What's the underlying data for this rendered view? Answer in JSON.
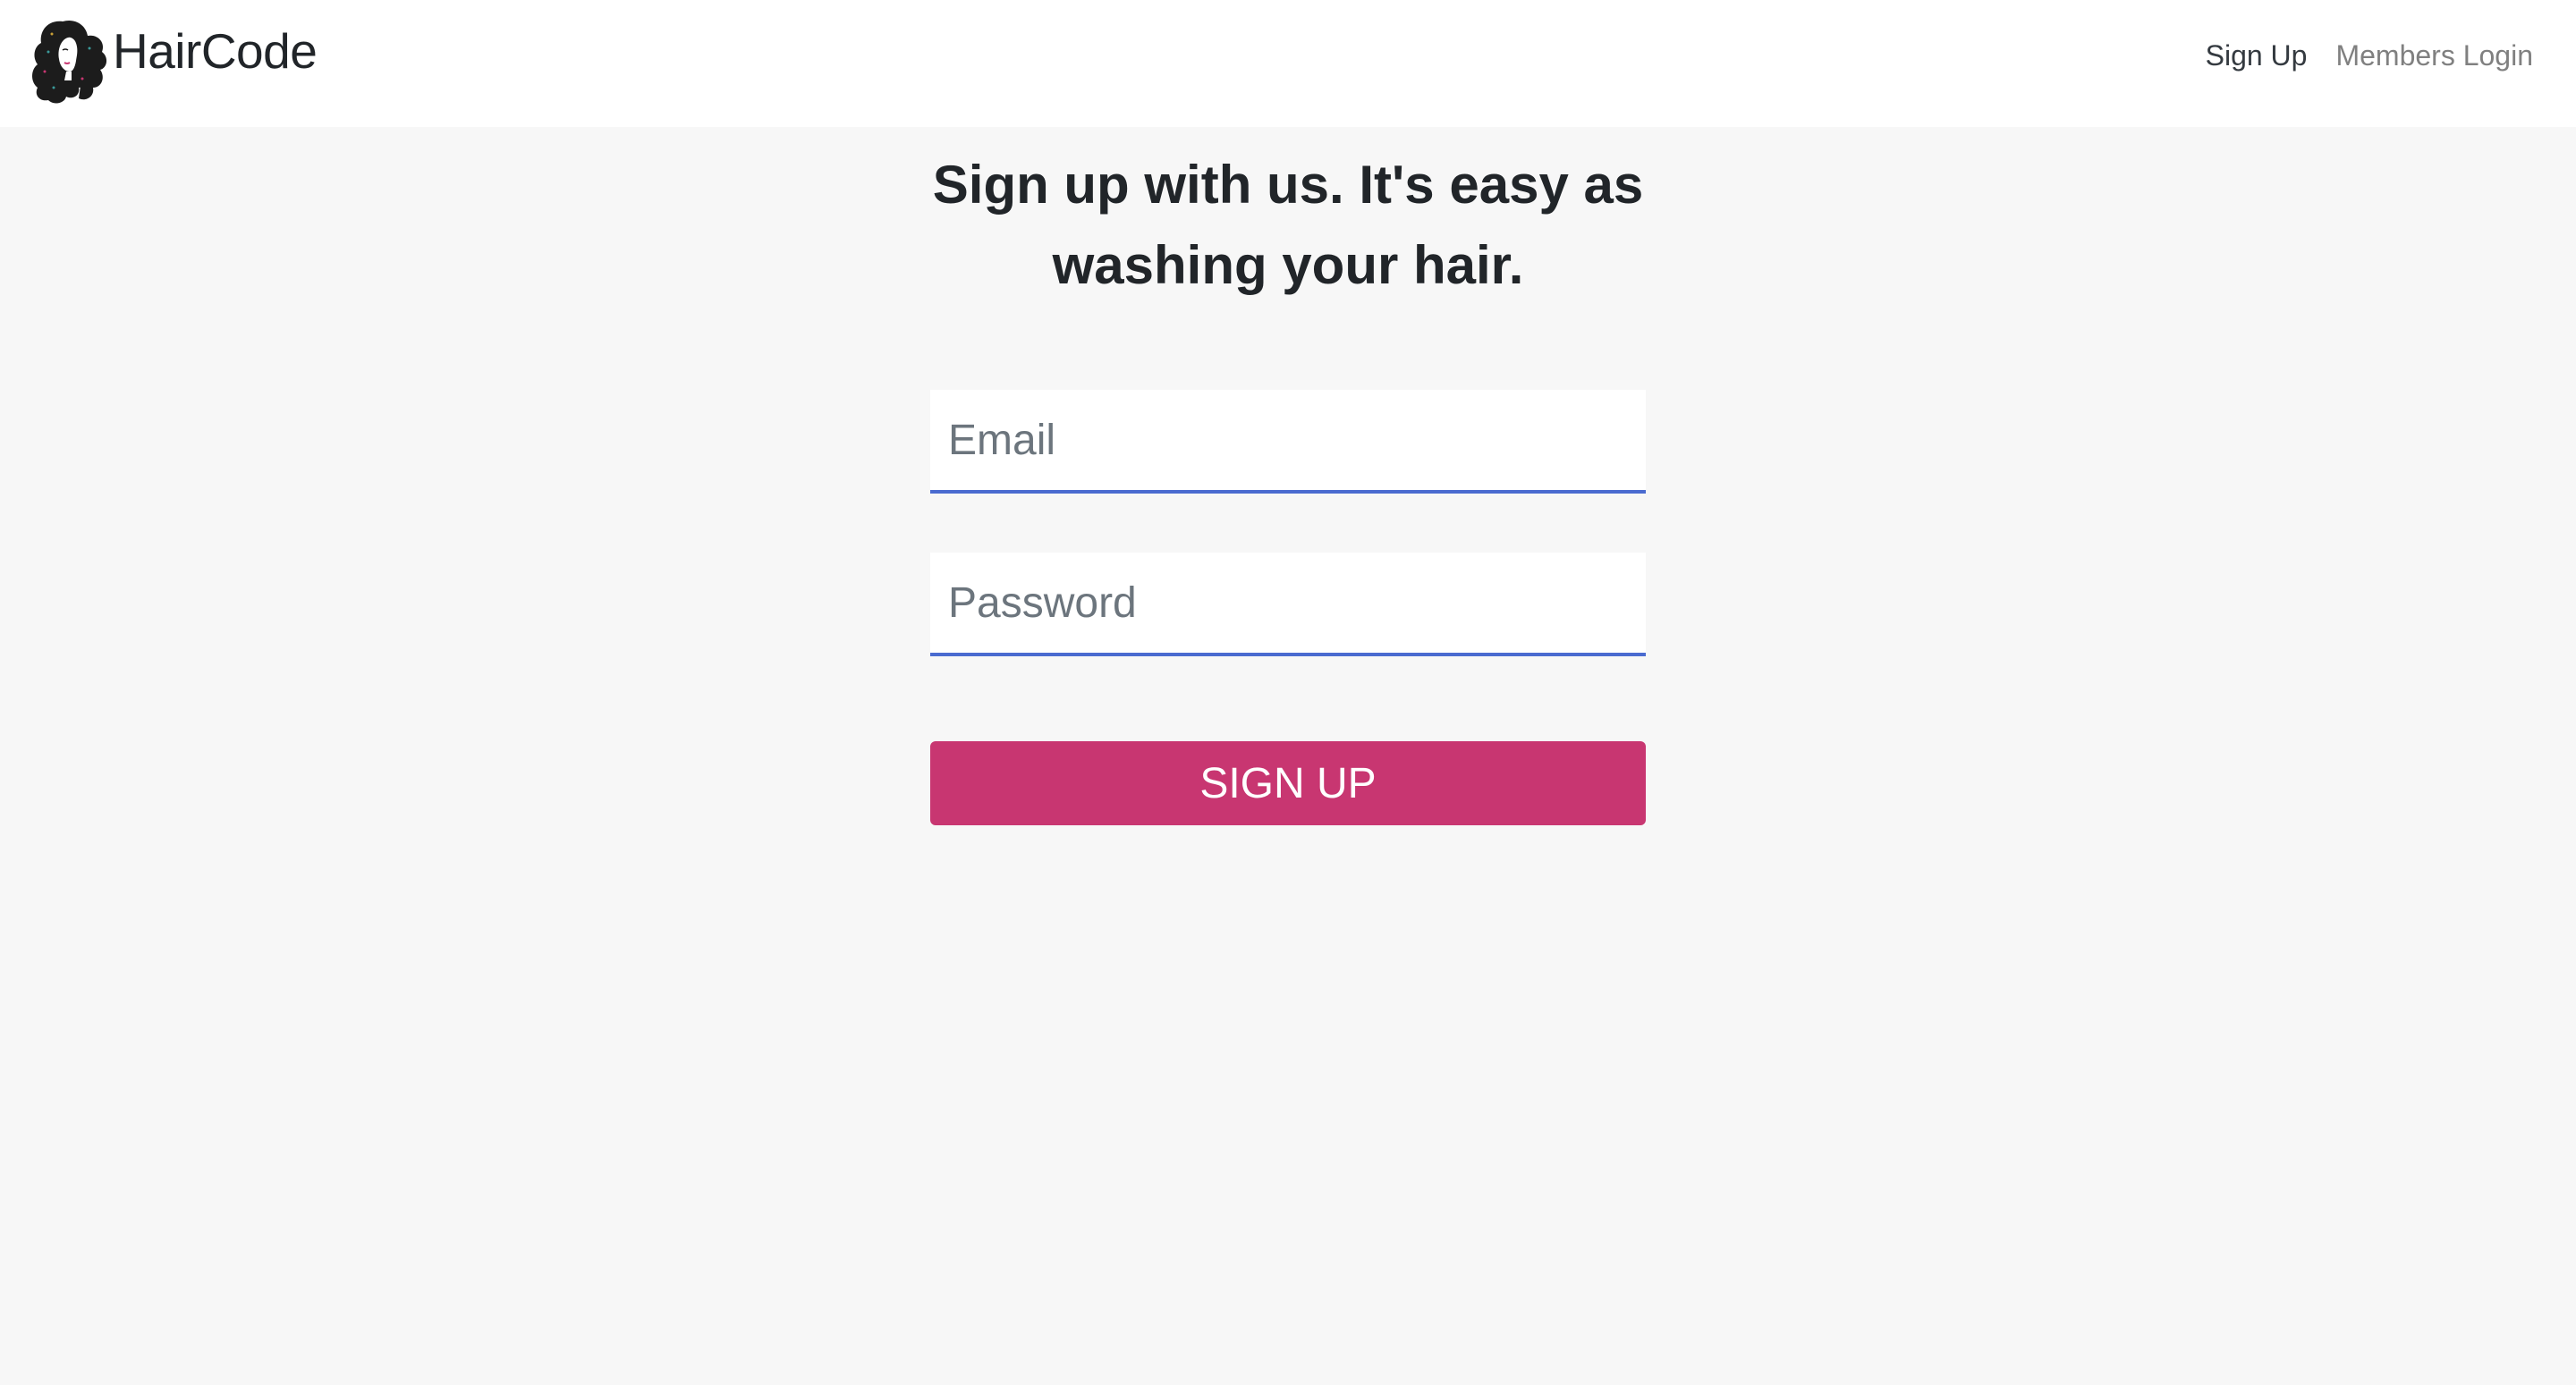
{
  "brand": {
    "name": "HairCode",
    "logo_icon": "woman-curly-hair-logo-icon"
  },
  "nav": {
    "items": [
      {
        "label": "Sign Up",
        "state": "active"
      },
      {
        "label": "Members Login",
        "state": "inactive"
      }
    ]
  },
  "form": {
    "heading": "Sign up with us. It's easy as washing your hair.",
    "email": {
      "placeholder": "Email",
      "value": ""
    },
    "password": {
      "placeholder": "Password",
      "value": ""
    },
    "submit_label": "SIGN UP"
  },
  "colors": {
    "page_background": "#f7f7f7",
    "navbar_background": "#ffffff",
    "accent": "#c83671",
    "input_underline": "#4a6bd0",
    "nav_active": "#343a40",
    "nav_muted": "#808080"
  }
}
